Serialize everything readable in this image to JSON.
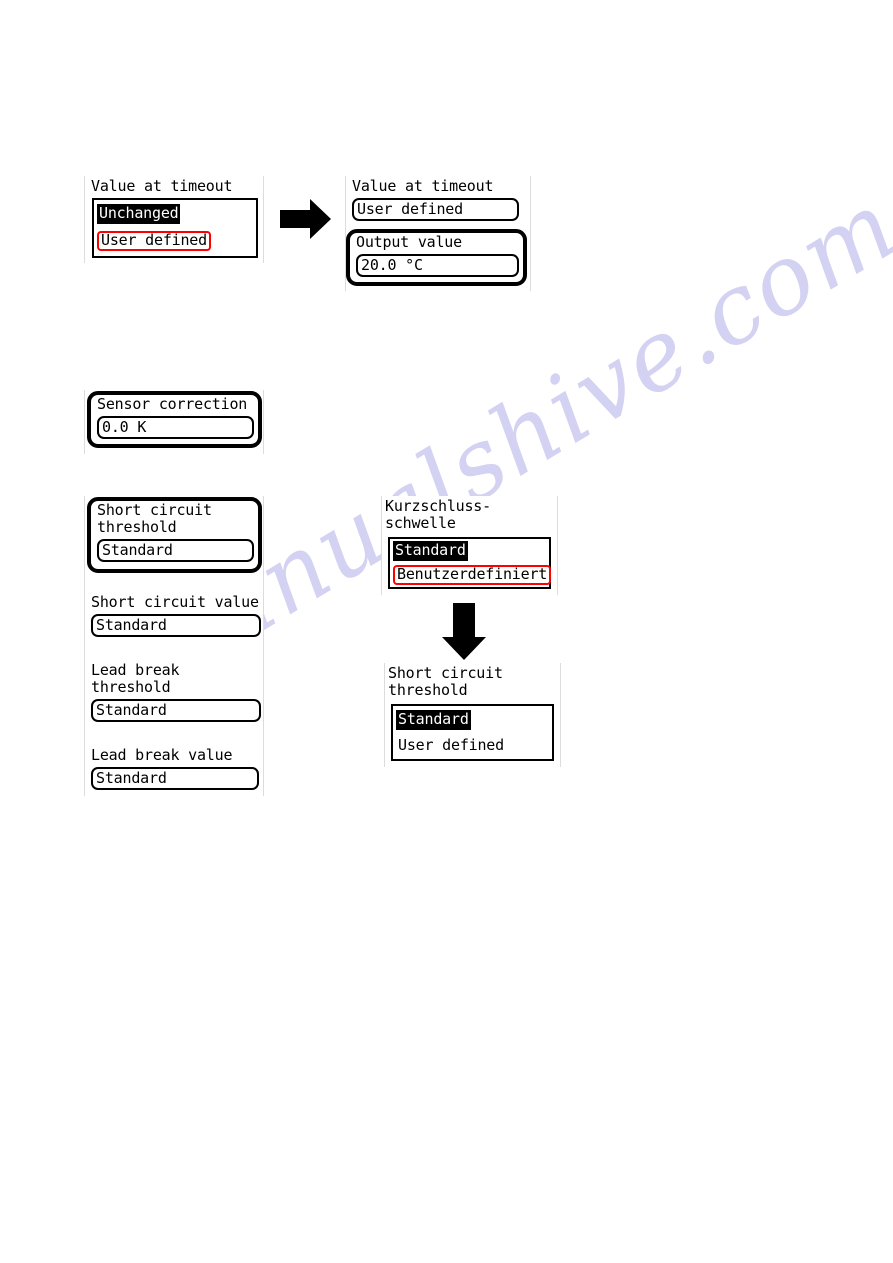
{
  "watermark": {
    "text": "manualshive.com",
    "color": "#d3d2f2"
  },
  "panels": {
    "timeout_before": {
      "title": "Value at timeout",
      "options": [
        {
          "label": "Unchanged",
          "state": "selected"
        },
        {
          "label": "User defined",
          "state": "highlighted-red"
        }
      ]
    },
    "timeout_after": {
      "title": "Value at timeout",
      "value": "User defined",
      "focused_label": "Output value",
      "focused_value": "20.0 °C"
    },
    "sensor_correction": {
      "label": "Sensor correction",
      "value": "0.0 K"
    },
    "thresholds": {
      "items": [
        {
          "label": "Short circuit\nthreshold",
          "value": "Standard",
          "focused": true
        },
        {
          "label": "Short circuit value",
          "value": "Standard",
          "focused": false
        },
        {
          "label": "Lead break\nthreshold",
          "value": "Standard",
          "focused": false
        },
        {
          "label": "Lead break value",
          "value": "Standard",
          "focused": false
        }
      ]
    },
    "kurzschluss": {
      "title": "Kurzschluss-\nschwelle",
      "options": [
        {
          "label": "Standard",
          "state": "selected"
        },
        {
          "label": "Benutzerdefiniert",
          "state": "highlighted-red"
        }
      ]
    },
    "short_circuit_threshold": {
      "title": "Short circuit\nthreshold",
      "options": [
        {
          "label": "Standard",
          "state": "selected"
        },
        {
          "label": "User defined",
          "state": "normal"
        }
      ]
    }
  },
  "arrows": {
    "right_arrow": "arrow-right-icon",
    "down_arrow": "arrow-down-icon"
  },
  "colors": {
    "highlight_red": "#ff0000",
    "lcd_black": "#000000",
    "bezel": "#dcdcdc"
  }
}
